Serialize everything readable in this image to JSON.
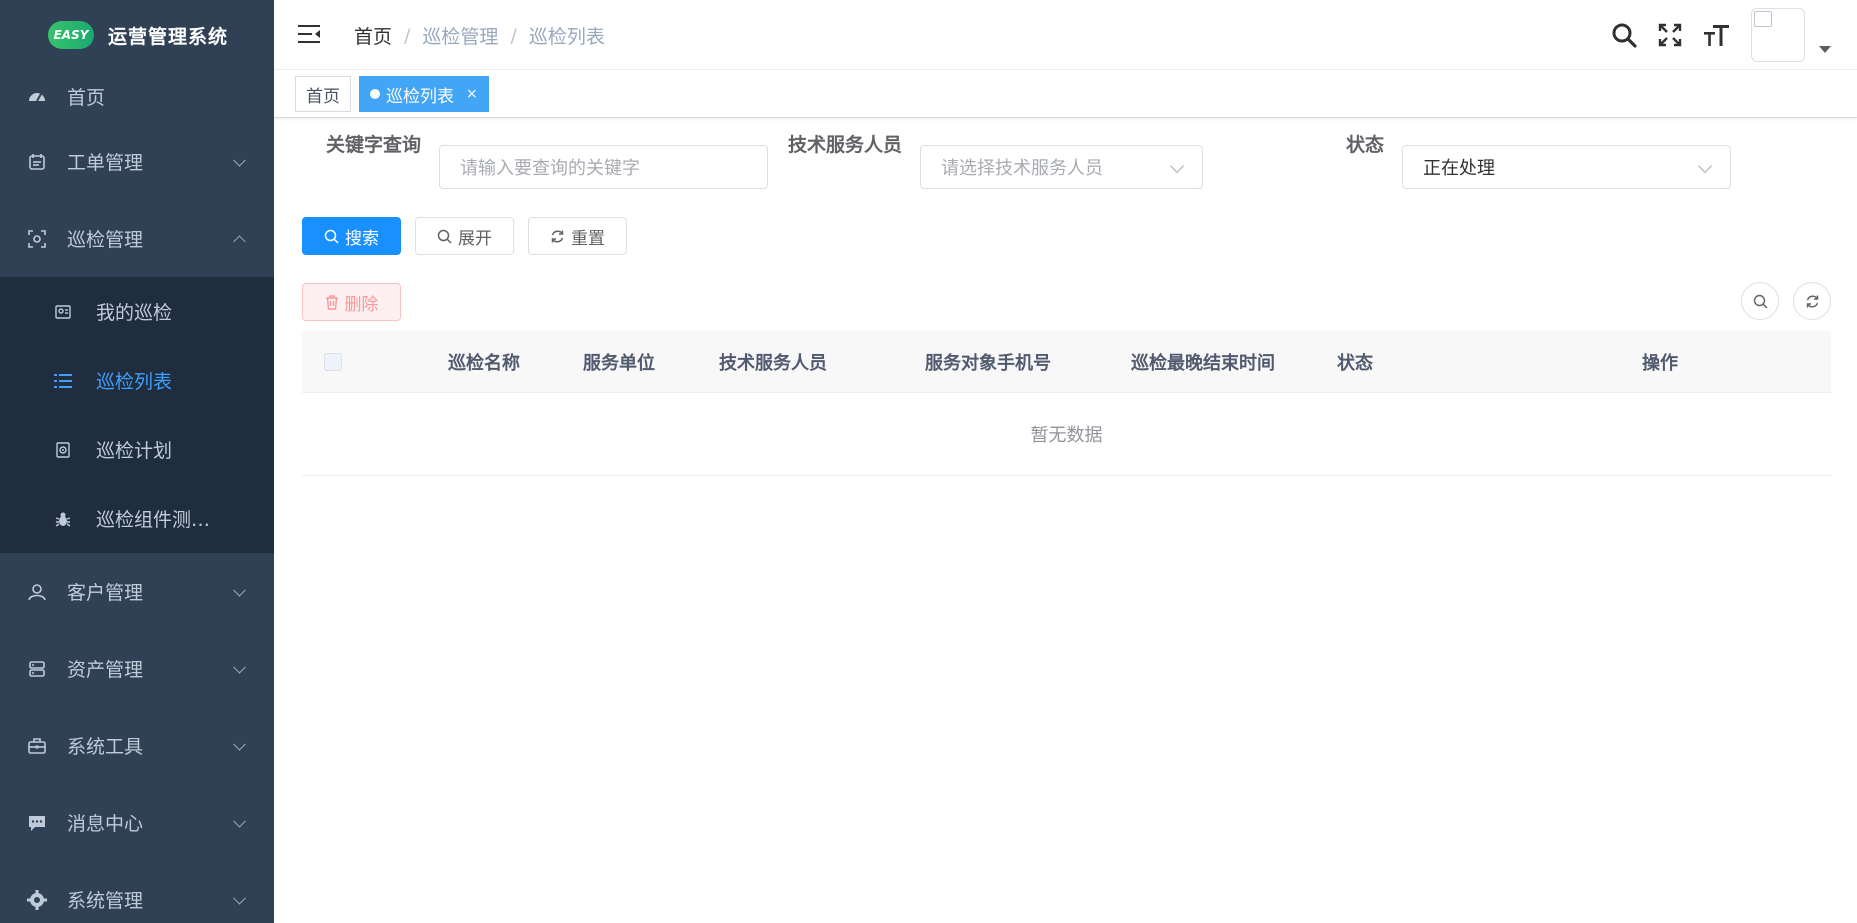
{
  "app": {
    "logo_badge": "EASY",
    "title": "运营管理系统"
  },
  "sidebar": {
    "items": [
      {
        "label": "首页",
        "icon": "dashboard-icon"
      },
      {
        "label": "工单管理",
        "icon": "calendar-icon"
      },
      {
        "label": "巡检管理",
        "icon": "inspect-icon",
        "expanded": true,
        "children": [
          {
            "label": "我的巡检",
            "icon": "my-inspect-icon"
          },
          {
            "label": "巡检列表",
            "icon": "list-icon",
            "active": true
          },
          {
            "label": "巡检计划",
            "icon": "plan-icon"
          },
          {
            "label": "巡检组件测…",
            "icon": "bug-icon"
          }
        ]
      },
      {
        "label": "客户管理",
        "icon": "user-icon"
      },
      {
        "label": "资产管理",
        "icon": "server-icon"
      },
      {
        "label": "系统工具",
        "icon": "toolbox-icon"
      },
      {
        "label": "消息中心",
        "icon": "message-icon"
      },
      {
        "label": "系统管理",
        "icon": "gear-icon"
      }
    ]
  },
  "breadcrumb": [
    "首页",
    "巡检管理",
    "巡检列表"
  ],
  "breadcrumb_sep": "/",
  "tags": [
    {
      "label": "首页"
    },
    {
      "label": "巡检列表",
      "active": true,
      "close": "×"
    }
  ],
  "filters": {
    "keyword_label": "关键字查询",
    "keyword_placeholder": "请输入要查询的关键字",
    "tech_label": "技术服务人员",
    "tech_placeholder": "请选择技术服务人员",
    "status_label": "状态",
    "status_value": "正在处理"
  },
  "buttons": {
    "search": "搜索",
    "expand": "展开",
    "reset": "重置",
    "delete": "删除"
  },
  "table": {
    "columns": [
      "巡检名称",
      "服务单位",
      "技术服务人员",
      "服务对象手机号",
      "巡检最晚结束时间",
      "状态",
      "操作"
    ],
    "empty_text": "暂无数据"
  },
  "colors": {
    "sidebar_bg": "#304156",
    "submenu_bg": "#1f2d3d",
    "accent": "#409eff",
    "primary_button": "#1890ff"
  }
}
